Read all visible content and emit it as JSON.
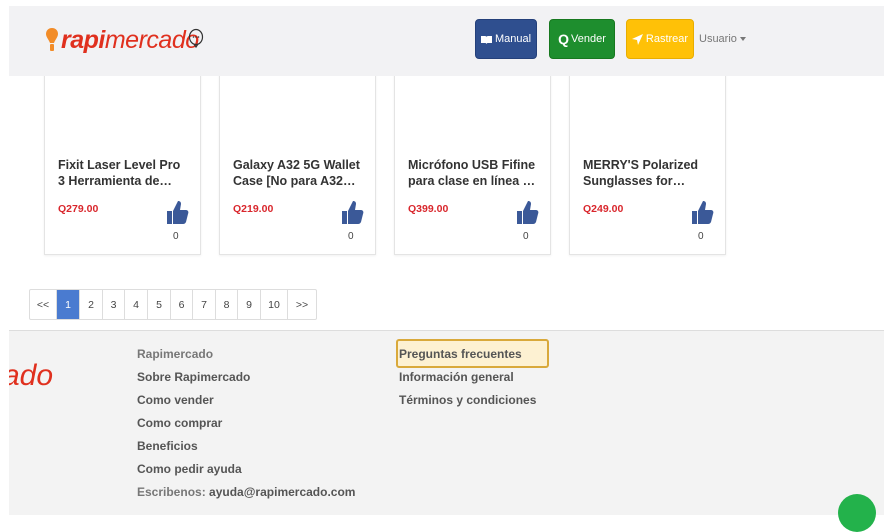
{
  "header": {
    "brand_bold": "rapi",
    "brand_light": "mercado",
    "buttons": {
      "manual": "Manual",
      "vender_prefix": "Q",
      "vender": "Vender",
      "rastrear": "Rastrear"
    },
    "user_menu": "Usuario"
  },
  "products": [
    {
      "title": "Fixit Laser Level Pro 3 Herramienta de…",
      "price": "Q279.00",
      "likes": "0"
    },
    {
      "title": "Galaxy A32 5G Wallet Case [No para A32…",
      "price": "Q219.00",
      "likes": "0"
    },
    {
      "title": "Micrófono USB Fifine para clase en línea …",
      "price": "Q399.00",
      "likes": "0"
    },
    {
      "title": "MERRY'S Polarized Sunglasses for…",
      "price": "Q249.00",
      "likes": "0"
    }
  ],
  "pagination": {
    "prev": "<<",
    "pages": [
      "1",
      "2",
      "3",
      "4",
      "5",
      "6",
      "7",
      "8",
      "9",
      "10"
    ],
    "active": "1",
    "next": ">>"
  },
  "footer": {
    "logo_fragment": "ado",
    "col1": {
      "heading": "Rapimercado",
      "links": [
        "Sobre Rapimercado",
        "Como vender",
        "Como comprar",
        "Beneficios",
        "Como pedir ayuda"
      ],
      "email_label": "Escribenos:",
      "email": "ayuda@rapimercado.com"
    },
    "col2": {
      "links": [
        "Preguntas frecuentes",
        "Información general",
        "Términos y condiciones"
      ]
    }
  },
  "colors": {
    "brand_red": "#e0301e",
    "manual_btn": "#2f4f8f",
    "vender_btn": "#1e8e2e",
    "rastrear_btn": "#ffc107",
    "price_red": "#d9262c",
    "pager_active": "#4a7bd0",
    "thumb_blue": "#3b5998"
  },
  "icons": [
    "map-pin-icon",
    "chat-bubble-icon",
    "book-icon",
    "navigation-arrow-icon",
    "thumbs-up-icon",
    "whatsapp-chat-icon"
  ]
}
